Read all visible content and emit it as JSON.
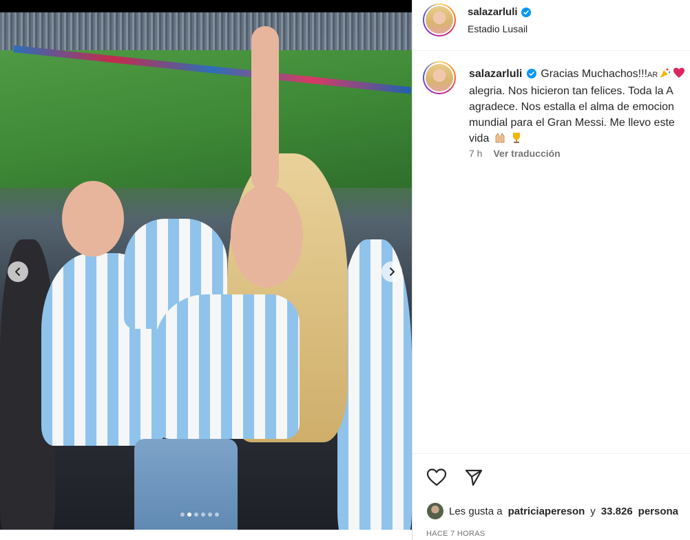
{
  "post": {
    "username": "salazarluli",
    "location": "Estadio Lusail",
    "caption_lines": [
      "Gracias Muchachos!!!",
      "alegria. Nos hicieron tan felices. Toda la A",
      "agradece. Nos estalla el alma de emocion",
      "mundial para el Gran Messi. Me llevo este",
      "vida"
    ],
    "caption_flag_text": "AR",
    "time_short": "7 h",
    "translate_label": "Ver traducción",
    "likes_prefix": "Les gusta a",
    "likes_user": "patriciapereson",
    "likes_and": "y",
    "likes_count": "33.826",
    "likes_suffix": "persona",
    "time_ago": "HACE 7 HORAS"
  },
  "carousel": {
    "total_slides": 6,
    "active_index": 1
  },
  "colors": {
    "verified": "#0095f6",
    "meta": "#737373",
    "text": "#262626"
  },
  "icons": {
    "prev": "chevron-left-icon",
    "next": "chevron-right-icon",
    "like": "heart-icon",
    "share": "paper-plane-icon",
    "verified": "verified-badge-icon"
  }
}
